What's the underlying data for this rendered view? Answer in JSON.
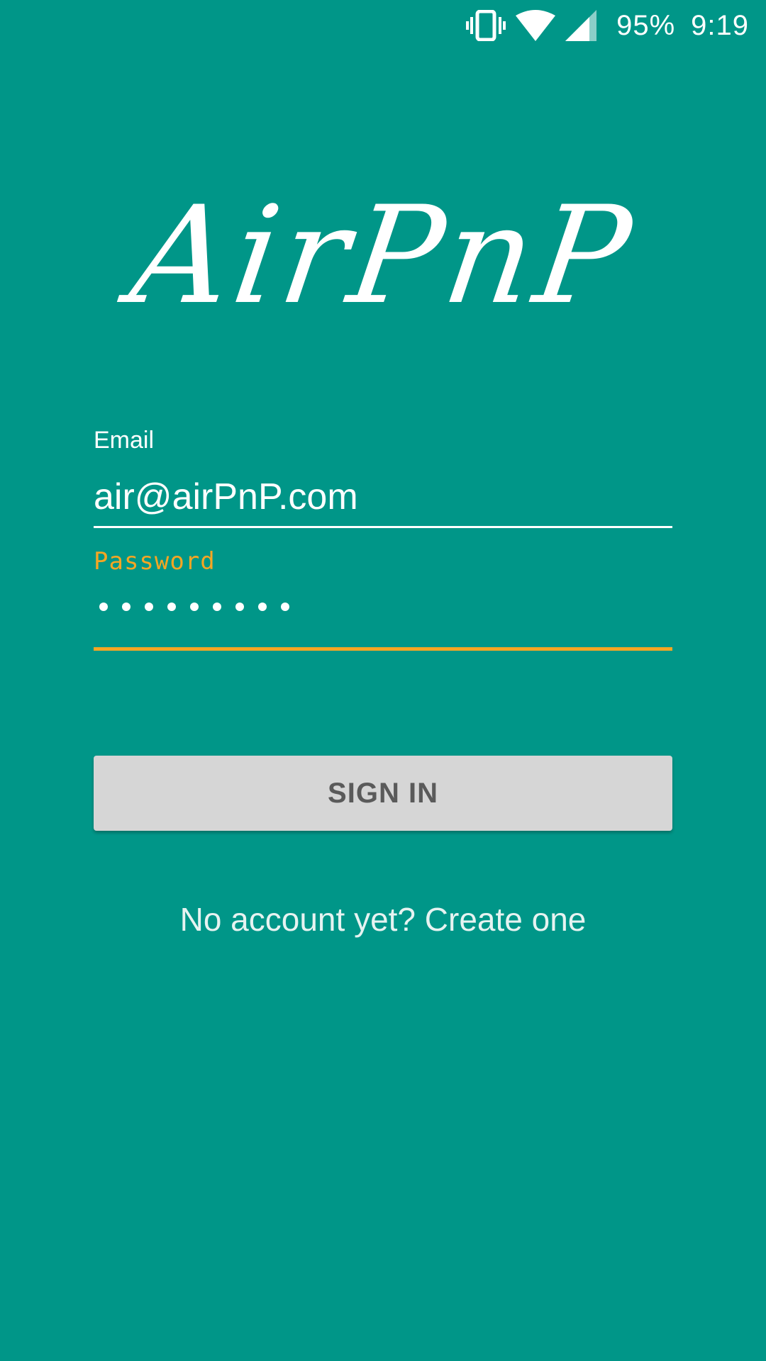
{
  "status_bar": {
    "battery": "95%",
    "time": "9:19",
    "icons": [
      "vibrate-icon",
      "wifi-icon",
      "cellular-signal-icon"
    ]
  },
  "logo": {
    "text": "AirPnP"
  },
  "form": {
    "email_label": "Email",
    "email_value": "air@airPnP.com",
    "password_label": "Password",
    "password_length": 9,
    "signin_label": "SIGN IN",
    "create_account_label": "No account yet? Create one"
  },
  "colors": {
    "background": "#009688",
    "accent": "#f5a623",
    "button": "#d6d6d6",
    "button_text": "#5a5a5a"
  }
}
